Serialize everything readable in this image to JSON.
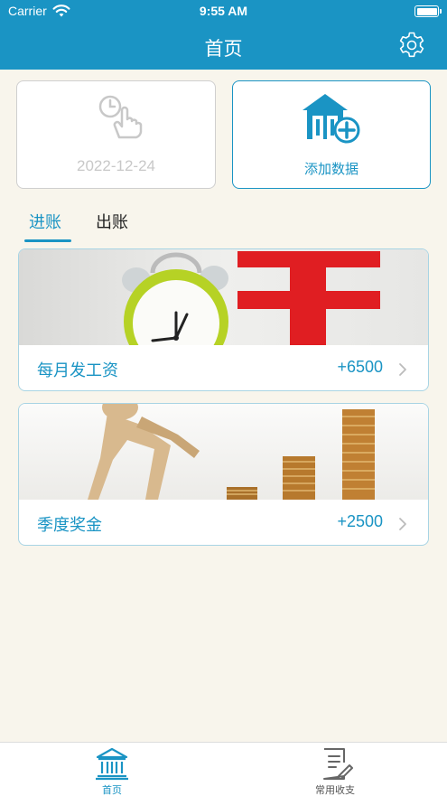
{
  "status": {
    "carrier": "Carrier",
    "time": "9:55 AM"
  },
  "header": {
    "title": "首页"
  },
  "top_cards": {
    "date": "2022-12-24",
    "add_label": "添加数据"
  },
  "tabs": [
    {
      "label": "进账",
      "active": true
    },
    {
      "label": "出账",
      "active": false
    }
  ],
  "items": [
    {
      "name": "每月发工资",
      "amount": "+6500"
    },
    {
      "name": "季度奖金",
      "amount": "+2500"
    }
  ],
  "tabbar": [
    {
      "label": "首页",
      "active": true
    },
    {
      "label": "常用收支",
      "active": false
    }
  ],
  "colors": {
    "accent": "#1a94c4",
    "background": "#f8f5ec",
    "date_text": "#c8c8c8"
  },
  "icons": [
    "wifi-icon",
    "battery-icon",
    "settings-gear-icon",
    "clock-hand-icon",
    "house-add-icon",
    "alarm-clock-image",
    "coins-mannequin-image",
    "chevron-right-icon",
    "bank-icon",
    "document-edit-icon"
  ]
}
